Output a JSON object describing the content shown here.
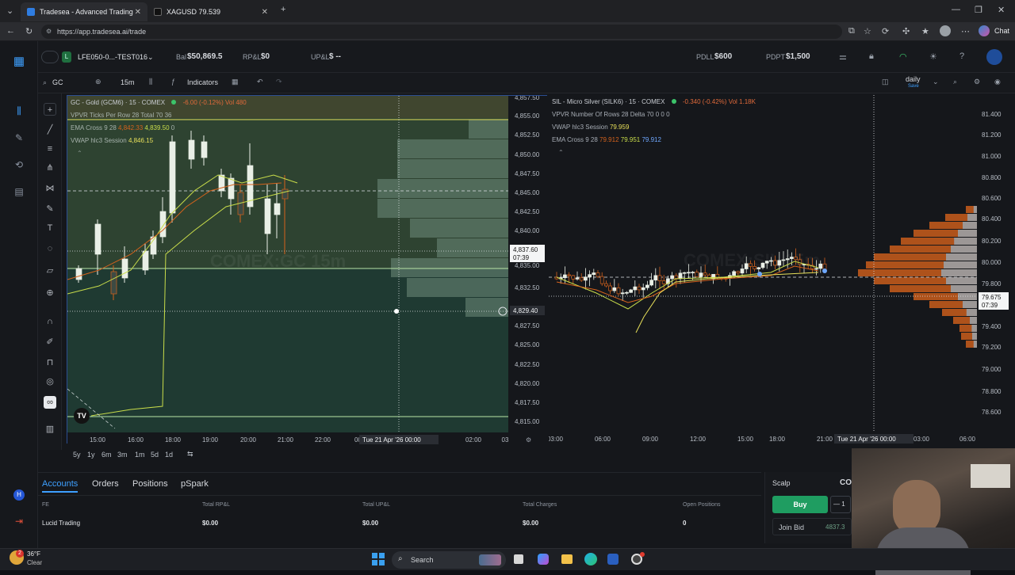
{
  "browser": {
    "tabs": [
      {
        "label": "Tradesea - Advanced Trading Dash",
        "active": true
      },
      {
        "label": "XAGUSD 79.539",
        "active": false
      }
    ],
    "url": "https://app.tradesea.ai/trade",
    "chat_label": "Chat"
  },
  "topbar": {
    "account": "LFE050-0...-TEST016",
    "bal_label": "Bal",
    "bal_value": "$50,869.5",
    "rpl_label": "RP&L",
    "rpl_value": "$0",
    "upl_label": "UP&L",
    "upl_value": "$ --",
    "pdll_label": "PDLL",
    "pdll_value": "$600",
    "pdpt_label": "PDPT",
    "pdpt_value": "$1,500"
  },
  "toolbar2": {
    "symbol": "GC",
    "interval": "15m",
    "indicators_label": "Indicators",
    "layout": "daily",
    "layout_sub": "Save"
  },
  "chart_left": {
    "title": "GC - Gold (GCM6) · 15 · COMEX",
    "change": "-6.00 (-0.12%)",
    "vol": "Vol 480",
    "line2": "VPVR Ticks Per Row 28 Total 70",
    "line2_val": "36",
    "line3": "EMA Cross 9 28",
    "line3_v1": "4,842.33",
    "line3_v2": "4,839.50",
    "line3_v3": "0",
    "line4": "VWAP hlc3 Session",
    "line4_v": "4,846.15",
    "watermark": "COMEX:GC 15m",
    "prices": [
      "4,857.50",
      "4,855.00",
      "4,852.50",
      "4,850.00",
      "4,847.50",
      "4,845.00",
      "4,842.50",
      "4,840.00",
      "4,837.60",
      "4,835.00",
      "4,832.50",
      "4,829.40",
      "4,827.50",
      "4,825.00",
      "4,822.50",
      "4,820.00",
      "4,817.50",
      "4,815.00"
    ],
    "last_price": "4,837.60",
    "countdown": "07:39",
    "cross_price": "4,829.40",
    "times": [
      "15:00",
      "16:00",
      "18:00",
      "19:00",
      "20:00",
      "21:00",
      "22:00",
      "00:00",
      "02:00",
      "03"
    ],
    "cross_time": "Tue 21 Apr '26   00:00"
  },
  "chart_right": {
    "title": "SIL - Micro Silver (SILK6) · 15 · COMEX",
    "change": "-0.340 (-0.42%)",
    "vol": "Vol 1.18K",
    "line2": "VPVR Number Of Rows 28 Delta 70",
    "line2_val": "0  0  0",
    "line3": "VWAP hlc3 Session",
    "line3_v": "79.959",
    "line4": "EMA Cross 9 28",
    "line4_v1": "79.912",
    "line4_v2": "79.951",
    "line4_v3": "79.912",
    "watermark": "COMEX:SIL 15m",
    "prices": [
      "81.400",
      "81.200",
      "81.000",
      "80.800",
      "80.600",
      "80.400",
      "80.200",
      "80.000",
      "79.800",
      "79.675",
      "79.400",
      "79.200",
      "79.000",
      "78.800",
      "78.600"
    ],
    "last_price": "79.675",
    "countdown": "07:39",
    "times": [
      "03:00",
      "06:00",
      "09:00",
      "12:00",
      "15:00",
      "18:00",
      "21:00",
      "03:00",
      "06:00"
    ],
    "cross_time": "Tue 21 Apr '26   00:00"
  },
  "ranges": [
    "5y",
    "1y",
    "6m",
    "3m",
    "1m",
    "5d",
    "1d"
  ],
  "accounts": {
    "tabs": [
      "Accounts",
      "Orders",
      "Positions",
      "pSpark"
    ],
    "columns": [
      "FE",
      "Total RP&L",
      "Total UP&L",
      "Total Charges",
      "Open Positions"
    ],
    "row": {
      "name": "Lucid Trading",
      "rpl": "$0.00",
      "upl": "$0.00",
      "charges": "$0.00",
      "open": "0"
    }
  },
  "scalp": {
    "title": "Scalp",
    "tab2": "CO",
    "buy_label": "Buy",
    "qty": "1",
    "join_bid_label": "Join Bid",
    "join_bid_value": "4837.3"
  },
  "taskbar": {
    "temp": "36°F",
    "weather": "Clear",
    "search": "Search",
    "badge": "2"
  },
  "colors": {
    "up": "#e9efe6",
    "down": "#d5621c",
    "accent": "#3ea0ff",
    "buy": "#1f9d61",
    "chart_left_bg": "#1f3a32"
  }
}
